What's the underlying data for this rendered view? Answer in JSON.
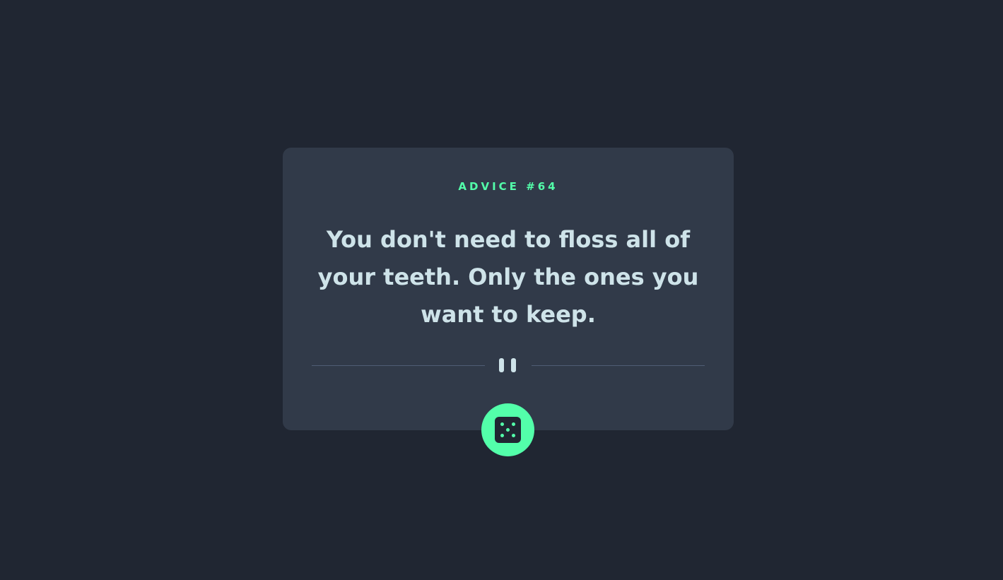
{
  "card": {
    "advice_label": "ADVICE #64",
    "advice_text": "You don't need to floss all of your teeth. Only the ones you want to keep."
  },
  "icons": {
    "divider_icon": "pause-icon",
    "button_icon": "dice-icon"
  },
  "colors": {
    "background": "#202632",
    "card": "#313a49",
    "accent": "#53ffaa",
    "text": "#cee3e9",
    "divider": "#4f5d74"
  }
}
